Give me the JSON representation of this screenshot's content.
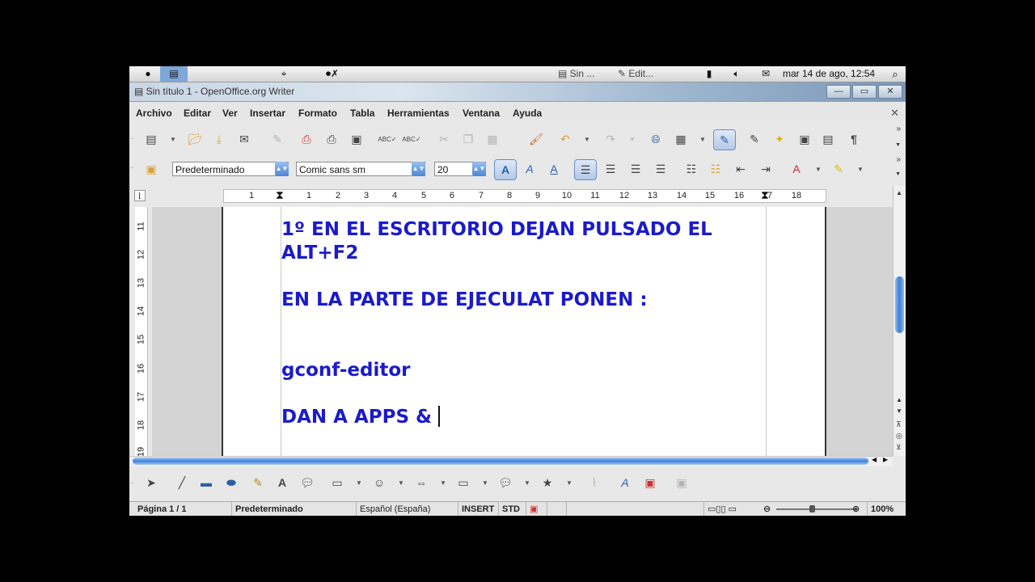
{
  "panel": {
    "tasks": [
      "Sin ...",
      "Edit..."
    ],
    "clock": "mar 14 de ago, 12:54"
  },
  "window": {
    "title": "Sin título 1 - OpenOffice.org Writer"
  },
  "menu": [
    "Archivo",
    "Editar",
    "Ver",
    "Insertar",
    "Formato",
    "Tabla",
    "Herramientas",
    "Ventana",
    "Ayuda"
  ],
  "formatting": {
    "style": "Predeterminado",
    "font": "Comic sans sm",
    "size": "20"
  },
  "ruler": {
    "numbers": [
      "1",
      "1",
      "2",
      "3",
      "4",
      "5",
      "6",
      "7",
      "8",
      "9",
      "10",
      "11",
      "12",
      "13",
      "14",
      "15",
      "16",
      "17",
      "18"
    ],
    "vertical_numbers": [
      "11",
      "12",
      "13",
      "14",
      "15",
      "16",
      "17",
      "18",
      "19"
    ]
  },
  "document": {
    "lines": [
      "1º EN EL ESCRITORIO DEJAN PULSADO EL ALT+F2",
      "",
      "EN LA PARTE DE EJECULAT PONEN :",
      "",
      "",
      "gconf-editor",
      "",
      "DAN A APPS &"
    ]
  },
  "status": {
    "page": "Página  1 / 1",
    "page_style": "Predeterminado",
    "language": "Español (España)",
    "insert_mode": "INSERT",
    "selection_mode": "STD",
    "zoom": "100%"
  },
  "colors": {
    "document_text": "#1b1bc8",
    "accent": "#3c7fd6"
  }
}
